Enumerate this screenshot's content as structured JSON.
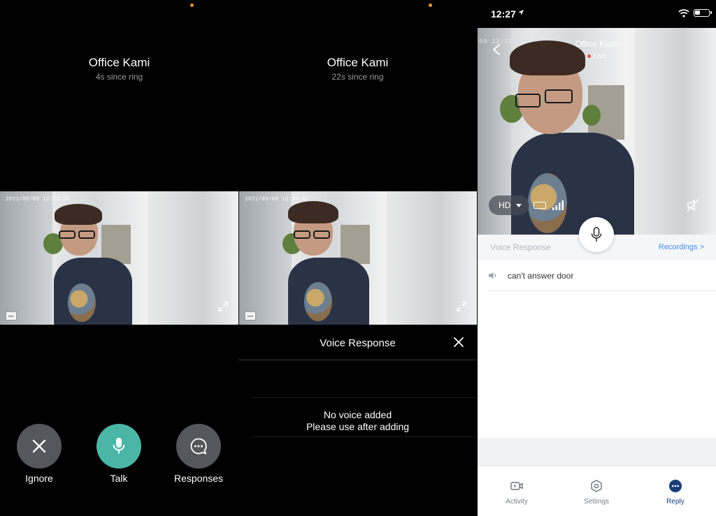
{
  "panel_left": {
    "title": "Office Kami",
    "subtitle": "4s since ring",
    "feed_timestamp": "2021/09/09  12:24:26",
    "actions": [
      {
        "label": "Ignore",
        "icon": "close-icon"
      },
      {
        "label": "Talk",
        "icon": "microphone-icon"
      },
      {
        "label": "Responses",
        "icon": "chat-bubble-icon"
      }
    ]
  },
  "panel_middle": {
    "title": "Office Kami",
    "subtitle": "22s since ring",
    "feed_timestamp": "2021/09/09  12:24:42",
    "sheet_title": "Voice Response",
    "empty_line1": "No voice added",
    "empty_line2": "Please use after adding"
  },
  "panel_right": {
    "status_time": "12:27",
    "camera_title": "Office Kami",
    "live_label": "Live",
    "overlay_timestamp": "09  12:27",
    "quality": "HD",
    "voice_response_label": "Voice Response",
    "recordings_link": "Recordings >",
    "responses": [
      "can't answer door"
    ],
    "tabs": [
      {
        "label": "Activity",
        "icon": "video-icon",
        "active": false
      },
      {
        "label": "Settings",
        "icon": "hexagon-gear-icon",
        "active": false
      },
      {
        "label": "Reply",
        "icon": "chat-bubble-icon",
        "active": true
      }
    ]
  },
  "colors": {
    "talk_teal": "#4bb6a6",
    "button_gray": "#55575d",
    "link_blue": "#3d8ee6",
    "active_navy": "#173e78",
    "notch_orange": "#f0912f"
  }
}
